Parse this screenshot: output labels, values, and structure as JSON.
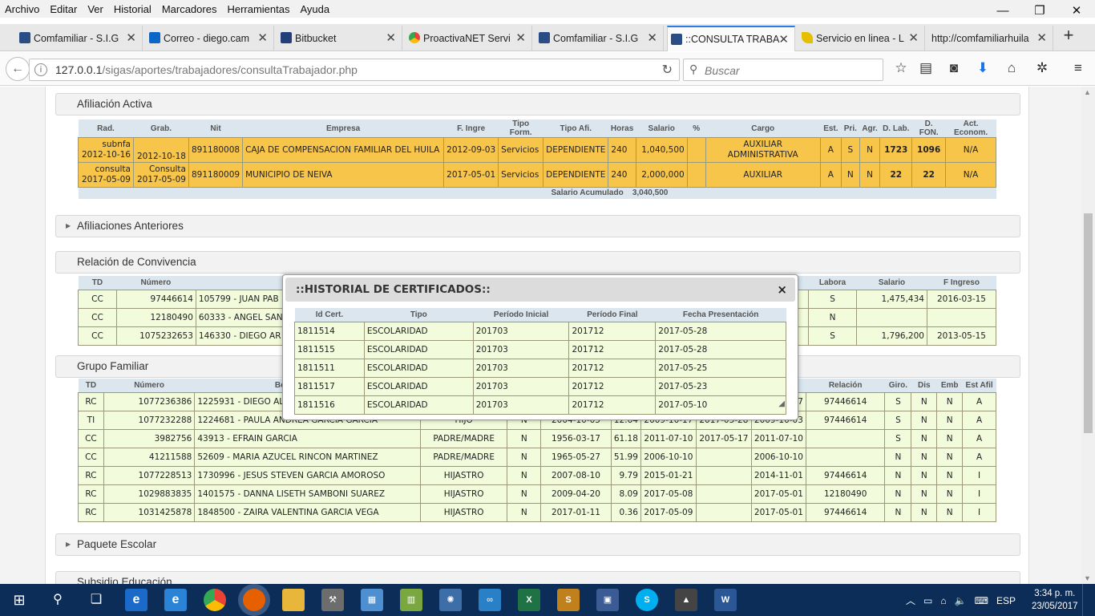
{
  "browser": {
    "menu": [
      "Archivo",
      "Editar",
      "Ver",
      "Historial",
      "Marcadores",
      "Herramientas",
      "Ayuda"
    ],
    "tabs": [
      {
        "title": "Comfamiliar - S.I.G",
        "color": "#2b4d86"
      },
      {
        "title": "Correo - diego.cam",
        "color": "#0a67c8"
      },
      {
        "title": "Bitbucket",
        "color": "#223f7a"
      },
      {
        "title": "ProactivaNET Servi",
        "color": "#e0a020"
      },
      {
        "title": "Comfamiliar - S.I.G",
        "color": "#2b4d86"
      },
      {
        "title": "::CONSULTA TRABA",
        "color": "#2b4d86"
      },
      {
        "title": "Servicio en linea - L",
        "color": "#e4c000"
      },
      {
        "title": "http://comfamiliarhuila",
        "color": "#ffffff"
      }
    ],
    "url_host": "127.0.0.1",
    "url_path": "/sigas/aportes/trabajadores/consultaTrabajador.php",
    "search_placeholder": "Buscar"
  },
  "afiliacion": {
    "title": "Afiliación Activa",
    "headers": [
      "Rad.",
      "Grab.",
      "Nit",
      "Empresa",
      "F. Ingre",
      "Tipo Form.",
      "Tipo Afi.",
      "Horas",
      "Salario",
      "%",
      "Cargo",
      "Est.",
      "Pri.",
      "Agr.",
      "D. Lab.",
      "D. FON.",
      "Act. Econom."
    ],
    "rows": [
      {
        "rad1": "subnfa",
        "rad2": "2012-10-16",
        "grab": "2012-10-18",
        "nit": "891180008",
        "empresa": "CAJA DE COMPENSACION FAMILIAR DEL HUILA",
        "fing": "2012-09-03",
        "tform": "Servicios",
        "tafi": "DEPENDIENTE",
        "horas": "240",
        "salario": "1,040,500",
        "pct": "",
        "cargo": "AUXILIAR ADMINISTRATIVA",
        "est": "A",
        "pri": "S",
        "agr": "N",
        "dlab": "1723",
        "dfon": "1096",
        "act": "N/A"
      },
      {
        "rad1": "consulta",
        "rad2": "2017-05-09",
        "grab1": "Consulta",
        "grab2": "2017-05-09",
        "nit": "891180009",
        "empresa": "MUNICIPIO DE NEIVA",
        "fing": "2017-05-01",
        "tform": "Servicios",
        "tafi": "DEPENDIENTE",
        "horas": "240",
        "salario": "2,000,000",
        "pct": "",
        "cargo": "AUXILIAR",
        "est": "A",
        "pri": "N",
        "agr": "N",
        "dlab": "22",
        "dfon": "22",
        "act": "N/A"
      }
    ],
    "acum_label": "Salario Acumulado",
    "acum_value": "3,040,500"
  },
  "anteriores": {
    "title": "Afiliaciones Anteriores"
  },
  "convivencia": {
    "title": "Relación de Convivencia",
    "headers": [
      "TD",
      "Número",
      "",
      "Labora",
      "Salario",
      "F Ingreso"
    ],
    "rows": [
      {
        "td": "CC",
        "num": "97446614",
        "nombre": "105799 - JUAN PAB",
        "labora": "S",
        "salario": "1,475,434",
        "fing": "2016-03-15"
      },
      {
        "td": "CC",
        "num": "12180490",
        "nombre": "60333 - ANGEL SAN",
        "labora": "N",
        "salario": "",
        "fing": ""
      },
      {
        "td": "CC",
        "num": "1075232653",
        "nombre": "146330 - DIEGO AR",
        "labora": "S",
        "salario": "1,796,200",
        "fing": "2013-05-15"
      }
    ]
  },
  "familiar": {
    "title": "Grupo Familiar",
    "headers": [
      "TD",
      "Número",
      "Be",
      "",
      "",
      "",
      "",
      "",
      "",
      "",
      "Relación",
      "Giro.",
      "Dis",
      "Emb",
      "Est Afil"
    ],
    "rows": [
      {
        "td": "RC",
        "num": "1077236386",
        "nombre": "1225931 - DIEGO ALEJA",
        "par": "",
        "conv": "",
        "fnac": "",
        "edad": "",
        "f1": "",
        "f2": "",
        "f3": "7",
        "rel": "97446614",
        "giro": "S",
        "dis": "N",
        "emb": "N",
        "est": "A"
      },
      {
        "td": "TI",
        "num": "1077232288",
        "nombre": "1224681 - PAULA ANDREA GARCIA GARCIA",
        "par": "HIJO",
        "conv": "N",
        "fnac": "2004-10-05",
        "edad": "12.64",
        "f1": "2009-10-17",
        "f2": "2017-05-28",
        "f3": "2009-10-03",
        "rel": "97446614",
        "giro": "S",
        "dis": "N",
        "emb": "N",
        "est": "A"
      },
      {
        "td": "CC",
        "num": "3982756",
        "nombre": "43913 - EFRAIN GARCIA",
        "par": "PADRE/MADRE",
        "conv": "N",
        "fnac": "1956-03-17",
        "edad": "61.18",
        "f1": "2011-07-10",
        "f2": "2017-05-17",
        "f3": "2011-07-10",
        "rel": "",
        "giro": "S",
        "dis": "N",
        "emb": "N",
        "est": "A"
      },
      {
        "td": "CC",
        "num": "41211588",
        "nombre": "52609 - MARIA AZUCEL RINCON MARTINEZ",
        "par": "PADRE/MADRE",
        "conv": "N",
        "fnac": "1965-05-27",
        "edad": "51.99",
        "f1": "2006-10-10",
        "f2": "",
        "f3": "2006-10-10",
        "rel": "",
        "giro": "N",
        "dis": "N",
        "emb": "N",
        "est": "A"
      },
      {
        "td": "RC",
        "num": "1077228513",
        "nombre": "1730996 - JESUS STEVEN GARCIA AMOROSO",
        "par": "HIJASTRO",
        "conv": "N",
        "fnac": "2007-08-10",
        "edad": "9.79",
        "f1": "2015-01-21",
        "f2": "",
        "f3": "2014-11-01",
        "rel": "97446614",
        "giro": "N",
        "dis": "N",
        "emb": "N",
        "est": "I"
      },
      {
        "td": "RC",
        "num": "1029883835",
        "nombre": "1401575 - DANNA LISETH SAMBONI SUAREZ",
        "par": "HIJASTRO",
        "conv": "N",
        "fnac": "2009-04-20",
        "edad": "8.09",
        "f1": "2017-05-08",
        "f2": "",
        "f3": "2017-05-01",
        "rel": "12180490",
        "giro": "N",
        "dis": "N",
        "emb": "N",
        "est": "I"
      },
      {
        "td": "RC",
        "num": "1031425878",
        "nombre": "1848500 - ZAIRA VALENTINA GARCIA VEGA",
        "par": "HIJASTRO",
        "conv": "N",
        "fnac": "2017-01-11",
        "edad": "0.36",
        "f1": "2017-05-09",
        "f2": "",
        "f3": "2017-05-01",
        "rel": "97446614",
        "giro": "N",
        "dis": "N",
        "emb": "N",
        "est": "I"
      }
    ]
  },
  "paquete": {
    "title": "Paquete Escolar"
  },
  "subsidio": {
    "title": "Subsidio Educación"
  },
  "modal": {
    "title": "::HISTORIAL DE CERTIFICADOS::",
    "close": "×",
    "headers": [
      "Id Cert.",
      "Tipo",
      "Período Inicial",
      "Período Final",
      "Fecha Presentación"
    ],
    "rows": [
      {
        "id": "1811514",
        "tipo": "ESCOLARIDAD",
        "pi": "201703",
        "pf": "201712",
        "fecha": "2017-05-28"
      },
      {
        "id": "1811515",
        "tipo": "ESCOLARIDAD",
        "pi": "201703",
        "pf": "201712",
        "fecha": "2017-05-28"
      },
      {
        "id": "1811511",
        "tipo": "ESCOLARIDAD",
        "pi": "201703",
        "pf": "201712",
        "fecha": "2017-05-25"
      },
      {
        "id": "1811517",
        "tipo": "ESCOLARIDAD",
        "pi": "201703",
        "pf": "201712",
        "fecha": "2017-05-23"
      },
      {
        "id": "1811516",
        "tipo": "ESCOLARIDAD",
        "pi": "201703",
        "pf": "201712",
        "fecha": "2017-05-10"
      }
    ]
  },
  "taskbar": {
    "time": "3:34 p. m.",
    "date": "23/05/2017",
    "lang": "ESP"
  }
}
